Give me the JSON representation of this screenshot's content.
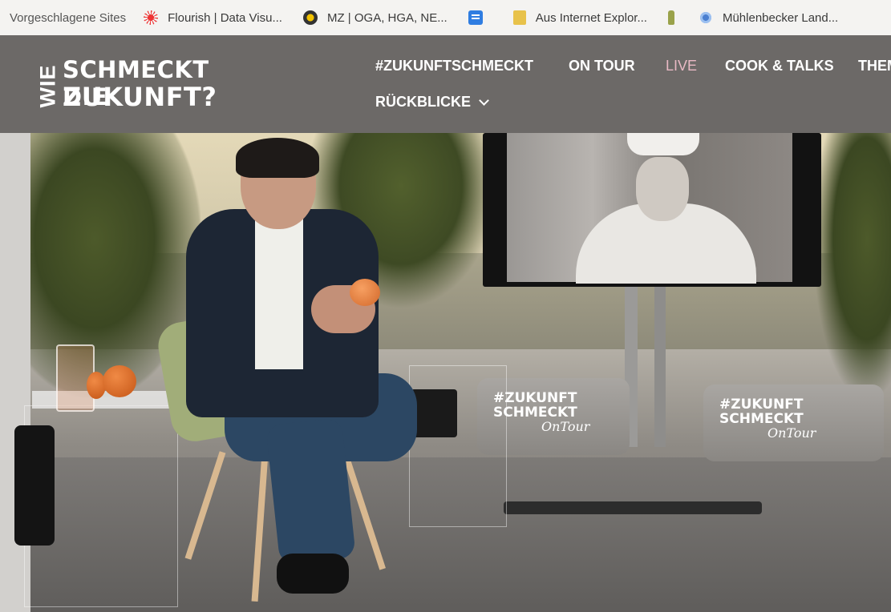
{
  "bookmarks": {
    "lead": "Vorgeschlagene Sites",
    "items": [
      {
        "label": "Flourish | Data Visu...",
        "icon": "flourish-icon"
      },
      {
        "label": "MZ | OGA, HGA, NE...",
        "icon": "mz-icon"
      },
      {
        "label": "",
        "icon": "doc-icon"
      },
      {
        "label": "Aus Internet Explor...",
        "icon": "folder-icon"
      },
      {
        "label": "",
        "icon": "bottle-icon"
      },
      {
        "label": "Mühlenbecker Land...",
        "icon": "gear-icon"
      }
    ]
  },
  "site": {
    "logo": {
      "wie": "WIE",
      "line1": "SCHMECKT DIE",
      "line2": "ZUKUNFT?"
    },
    "nav": {
      "items": [
        "#ZUKUNFTSCHMECKT",
        "ON TOUR",
        "LIVE",
        "COOK & TALKS",
        "THEM"
      ],
      "rueckblicke": "RÜCKBLICKE"
    }
  },
  "scene": {
    "banner1": {
      "title1": "#ZUKUNFT",
      "title2": "SCHMECKT",
      "sub": "OnTour"
    },
    "banner2": {
      "title1": "#ZUKUNFT",
      "title2": "SCHMECKT",
      "sub": "OnTour"
    }
  },
  "colors": {
    "header_bg": "#6c6967",
    "bookmarks_bg": "#f4f3f1",
    "live_accent": "#e9b9c4"
  }
}
